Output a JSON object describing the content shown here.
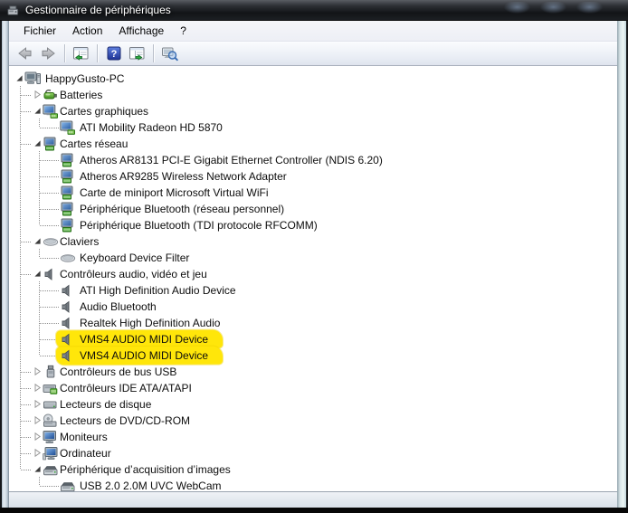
{
  "window": {
    "title": "Gestionnaire de périphériques"
  },
  "menu": {
    "items": [
      "Fichier",
      "Action",
      "Affichage",
      "?"
    ]
  },
  "toolbar": {
    "buttons": [
      "back-arrow",
      "forward-arrow",
      "|",
      "show-console-tree",
      "|",
      "help",
      "show-action-pane",
      "|",
      "scan-hardware-changes"
    ]
  },
  "tree": {
    "rows": [
      {
        "label": "HappyGusto-PC",
        "level": 0,
        "expander": "expanded",
        "icon": "computer-root",
        "highlight": false
      },
      {
        "label": "Batteries",
        "level": 1,
        "expander": "collapsed",
        "icon": "battery",
        "highlight": false
      },
      {
        "label": "Cartes graphiques",
        "level": 1,
        "expander": "expanded",
        "icon": "display-adapter",
        "highlight": false
      },
      {
        "label": "ATI Mobility Radeon HD 5870",
        "level": 2,
        "expander": "none",
        "icon": "display-adapter",
        "highlight": false
      },
      {
        "label": "Cartes réseau",
        "level": 1,
        "expander": "expanded",
        "icon": "network-adapter",
        "highlight": false
      },
      {
        "label": "Atheros AR8131 PCI-E Gigabit Ethernet Controller (NDIS 6.20)",
        "level": 2,
        "expander": "none",
        "icon": "network-adapter",
        "highlight": false
      },
      {
        "label": "Atheros AR9285 Wireless Network Adapter",
        "level": 2,
        "expander": "none",
        "icon": "network-adapter",
        "highlight": false
      },
      {
        "label": "Carte de miniport Microsoft Virtual WiFi",
        "level": 2,
        "expander": "none",
        "icon": "network-adapter",
        "highlight": false
      },
      {
        "label": "Périphérique Bluetooth (réseau personnel)",
        "level": 2,
        "expander": "none",
        "icon": "network-adapter",
        "highlight": false
      },
      {
        "label": "Périphérique Bluetooth (TDI protocole RFCOMM)",
        "level": 2,
        "expander": "none",
        "icon": "network-adapter",
        "highlight": false
      },
      {
        "label": "Claviers",
        "level": 1,
        "expander": "expanded",
        "icon": "keyboard",
        "highlight": false
      },
      {
        "label": "Keyboard Device Filter",
        "level": 2,
        "expander": "none",
        "icon": "keyboard",
        "highlight": false
      },
      {
        "label": "Contrôleurs audio, vidéo et jeu",
        "level": 1,
        "expander": "expanded",
        "icon": "speaker",
        "highlight": false
      },
      {
        "label": "ATI High Definition Audio Device",
        "level": 2,
        "expander": "none",
        "icon": "speaker",
        "highlight": false
      },
      {
        "label": "Audio Bluetooth",
        "level": 2,
        "expander": "none",
        "icon": "speaker",
        "highlight": false
      },
      {
        "label": "Realtek High Definition Audio",
        "level": 2,
        "expander": "none",
        "icon": "speaker",
        "highlight": false
      },
      {
        "label": "VMS4 AUDIO MIDI Device",
        "level": 2,
        "expander": "none",
        "icon": "speaker",
        "highlight": true
      },
      {
        "label": "VMS4 AUDIO MIDI Device",
        "level": 2,
        "expander": "none",
        "icon": "speaker",
        "highlight": true
      },
      {
        "label": "Contrôleurs de bus USB",
        "level": 1,
        "expander": "collapsed",
        "icon": "usb",
        "highlight": false
      },
      {
        "label": "Contrôleurs IDE ATA/ATAPI",
        "level": 1,
        "expander": "collapsed",
        "icon": "ide-controller",
        "highlight": false
      },
      {
        "label": "Lecteurs de disque",
        "level": 1,
        "expander": "collapsed",
        "icon": "disk-drive",
        "highlight": false
      },
      {
        "label": "Lecteurs de DVD/CD-ROM",
        "level": 1,
        "expander": "collapsed",
        "icon": "dvd-drive",
        "highlight": false
      },
      {
        "label": "Moniteurs",
        "level": 1,
        "expander": "collapsed",
        "icon": "monitor",
        "highlight": false
      },
      {
        "label": "Ordinateur",
        "level": 1,
        "expander": "collapsed",
        "icon": "computer-monitor",
        "highlight": false
      },
      {
        "label": "Périphérique d’acquisition d’images",
        "level": 1,
        "expander": "expanded",
        "icon": "imaging-device",
        "highlight": false
      },
      {
        "label": "USB 2.0 2.0M UVC WebCam",
        "level": 2,
        "expander": "none",
        "icon": "imaging-device",
        "highlight": false
      }
    ]
  },
  "colors": {
    "highlight_marker": "#ffe60a",
    "help_icon_blue": "#2f49a8",
    "tree_background": "#ffffff",
    "titlebar_dark": "#17191d"
  }
}
